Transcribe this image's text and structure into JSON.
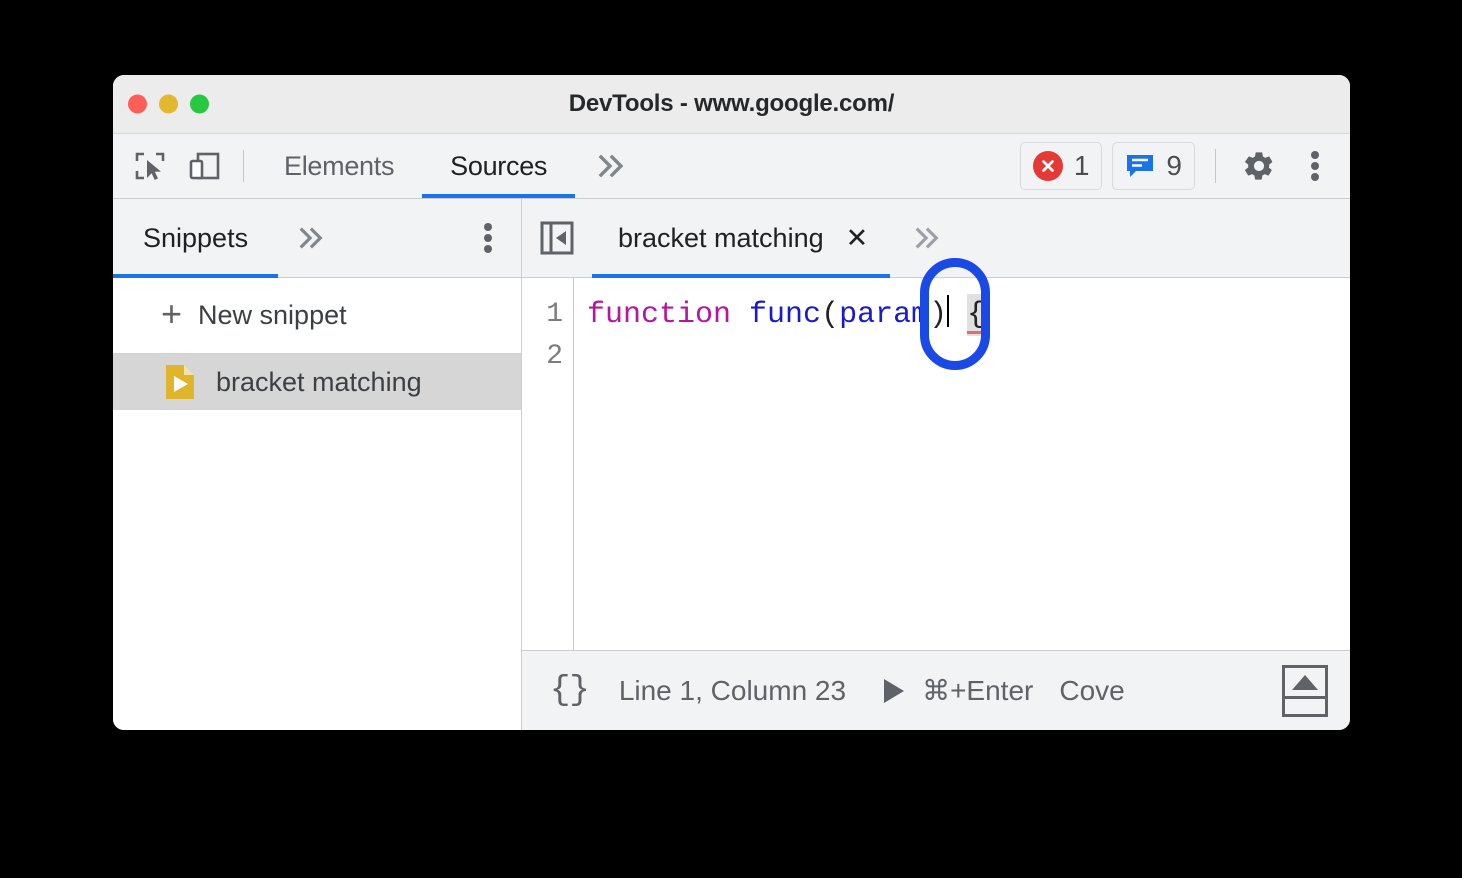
{
  "window": {
    "title": "DevTools - www.google.com/",
    "controls": [
      {
        "name": "close",
        "color": "#fd5f57"
      },
      {
        "name": "minimize",
        "color": "#e3b72e"
      },
      {
        "name": "maximize",
        "color": "#28c840"
      }
    ]
  },
  "toolbar": {
    "inspect_icon": "inspect-element-icon",
    "device_icon": "device-toolbar-icon",
    "tabs": [
      {
        "label": "Elements",
        "active": false
      },
      {
        "label": "Sources",
        "active": true
      }
    ],
    "more_tabs_label": "»",
    "errors": {
      "count": "1",
      "icon": "error-icon",
      "color": "#e53935"
    },
    "messages": {
      "count": "9",
      "icon": "message-icon",
      "color": "#1a73e8"
    },
    "settings_icon": "gear-icon",
    "menu_icon": "kebab-menu-icon"
  },
  "sidebar": {
    "tab_label": "Snippets",
    "more_label": "»",
    "menu_icon": "kebab-menu-icon",
    "new_snippet_label": "New snippet",
    "new_snippet_plus": "+",
    "items": [
      {
        "label": "bracket matching",
        "icon": "snippet-file-icon",
        "selected": true
      }
    ]
  },
  "editor": {
    "collapse_navigator_icon": "collapse-navigator-icon",
    "tab_label": "bracket matching",
    "tab_close_label": "✕",
    "more_label": "»",
    "line_numbers": [
      "1",
      "2"
    ],
    "code": {
      "keyword": "function",
      "space1": " ",
      "function_name": "func",
      "paren_open": "(",
      "param": "param",
      "paren_close": ")",
      "space2": " ",
      "brace": "{"
    },
    "annotation": {
      "shape": "rounded-rect-highlight",
      "color": "#1b49e5",
      "target": "{"
    }
  },
  "statusbar": {
    "pretty_print_label": "{}",
    "position_label": "Line 1, Column 23",
    "run_icon": "play-icon",
    "shortcut_label": "⌘+Enter",
    "coverage_label": "Cove",
    "drawer_icon": "show-drawer-icon"
  }
}
